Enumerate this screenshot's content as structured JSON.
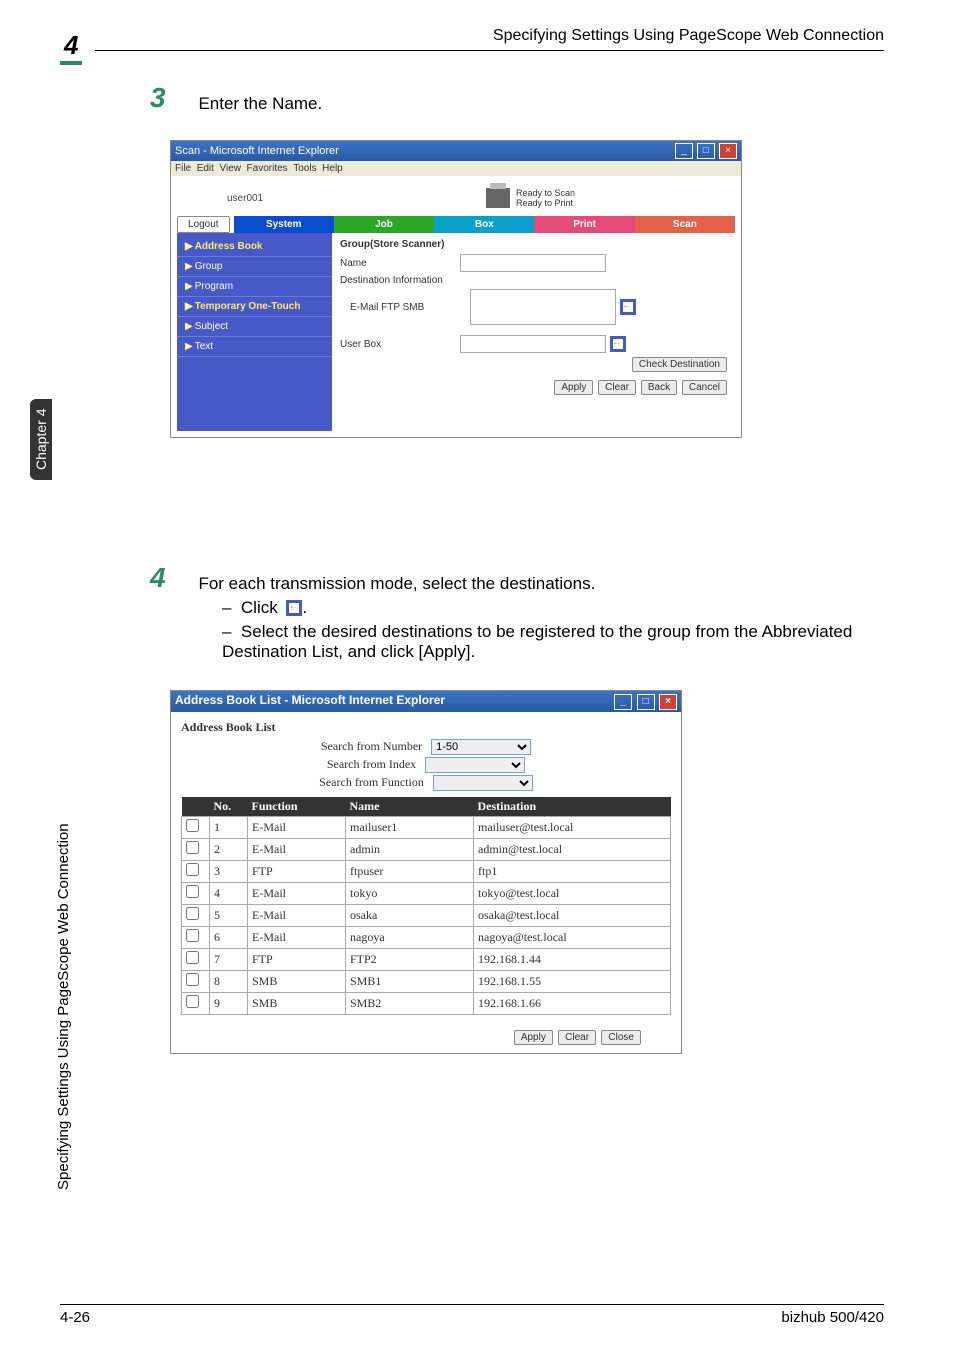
{
  "page": {
    "chapter_number": "4",
    "header_title": "Specifying Settings Using PageScope Web Connection",
    "side_tab": "Chapter 4",
    "side_label": "Specifying Settings Using PageScope Web Connection",
    "footer_page": "4-26",
    "footer_model": "bizhub 500/420"
  },
  "steps": {
    "s3": {
      "num": "3",
      "text": "Enter the Name."
    },
    "s4": {
      "num": "4",
      "text": "For each transmission mode, select the destinations.",
      "bullet1_prefix": "Click ",
      "bullet1_suffix": ".",
      "bullet2": "Select the desired destinations to be registered to the group from the Abbreviated Destination List, and click [Apply]."
    }
  },
  "shot1": {
    "title": "Scan - Microsoft Internet Explorer",
    "menubar": [
      "File",
      "Edit",
      "View",
      "Favorites",
      "Tools",
      "Help"
    ],
    "user": "user001",
    "status1": "Ready to Scan",
    "status2": "Ready to Print",
    "logout_btn": "Logout",
    "tabs": {
      "system": "System",
      "job": "Job",
      "box": "Box",
      "print": "Print",
      "scan": "Scan"
    },
    "nav": [
      "Address Book",
      "Group",
      "Program",
      "Temporary One-Touch",
      "Subject",
      "Text"
    ],
    "panel": {
      "heading": "Group(Store Scanner)",
      "name_label": "Name",
      "dest_label": "Destination Information",
      "dest_sub": "E-Mail FTP SMB",
      "userbox_label": "User Box",
      "check_dest_btn": "Check Destination",
      "btns": {
        "apply": "Apply",
        "clear": "Clear",
        "back": "Back",
        "cancel": "Cancel"
      }
    }
  },
  "shot2": {
    "title": "Address Book List - Microsoft Internet Explorer",
    "list_title": "Address Book List",
    "filters": {
      "f1": "Search from Number",
      "f1_val": "1-50",
      "f2": "Search from Index",
      "f2_val": "",
      "f3": "Search from Function",
      "f3_val": ""
    },
    "headers": {
      "no": "No.",
      "func": "Function",
      "name": "Name",
      "dest": "Destination"
    },
    "rows": [
      {
        "no": "1",
        "func": "E-Mail",
        "name": "mailuser1",
        "dest": "mailuser@test.local"
      },
      {
        "no": "2",
        "func": "E-Mail",
        "name": "admin",
        "dest": "admin@test.local"
      },
      {
        "no": "3",
        "func": "FTP",
        "name": "ftpuser",
        "dest": "ftp1"
      },
      {
        "no": "4",
        "func": "E-Mail",
        "name": "tokyo",
        "dest": "tokyo@test.local"
      },
      {
        "no": "5",
        "func": "E-Mail",
        "name": "osaka",
        "dest": "osaka@test.local"
      },
      {
        "no": "6",
        "func": "E-Mail",
        "name": "nagoya",
        "dest": "nagoya@test.local"
      },
      {
        "no": "7",
        "func": "FTP",
        "name": "FTP2",
        "dest": "192.168.1.44"
      },
      {
        "no": "8",
        "func": "SMB",
        "name": "SMB1",
        "dest": "192.168.1.55"
      },
      {
        "no": "9",
        "func": "SMB",
        "name": "SMB2",
        "dest": "192.168.1.66"
      }
    ],
    "btns": {
      "apply": "Apply",
      "clear": "Clear",
      "close": "Close"
    }
  }
}
